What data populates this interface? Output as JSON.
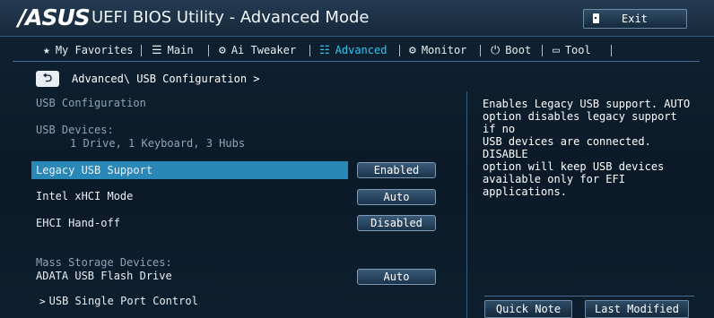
{
  "header": {
    "logo": "ASUS",
    "title": "UEFI BIOS Utility - Advanced Mode",
    "exit_label": "Exit"
  },
  "tabs": [
    {
      "label": "My Favorites",
      "icon": "star-icon"
    },
    {
      "label": "Main",
      "icon": "list-icon"
    },
    {
      "label": "Ai Tweaker",
      "icon": "ai-tweaker-icon"
    },
    {
      "label": "Advanced",
      "icon": "advanced-icon",
      "active": true
    },
    {
      "label": "Monitor",
      "icon": "monitor-icon"
    },
    {
      "label": "Boot",
      "icon": "power-icon"
    },
    {
      "label": "Tool",
      "icon": "tool-icon"
    }
  ],
  "breadcrumb": "Advanced\\ USB Configuration >",
  "content": {
    "section_title": "USB Configuration",
    "usb_devices_label": "USB Devices:",
    "usb_devices_value": "1 Drive, 1 Keyboard, 3 Hubs",
    "settings": [
      {
        "label": "Legacy USB Support",
        "value": "Enabled",
        "selected": true
      },
      {
        "label": "Intel xHCI Mode",
        "value": "Auto"
      },
      {
        "label": "EHCI Hand-off",
        "value": "Disabled"
      }
    ],
    "mass_storage_label": "Mass Storage Devices:",
    "mass_storage_device": {
      "label": "ADATA USB Flash Drive",
      "value": "Auto"
    },
    "submenu": "USB Single Port Control"
  },
  "help_text": "Enables Legacy USB support. AUTO\noption disables legacy support if no\nUSB devices are connected. DISABLE\noption will keep USB devices\navailable only for EFI applications.",
  "footer": {
    "quick_note": "Quick Note",
    "last_modified": "Last Modified"
  },
  "colors": {
    "active_tab": "#2fc6f2",
    "highlight_row": "#2a88b8",
    "background": "#0e1d2b"
  }
}
